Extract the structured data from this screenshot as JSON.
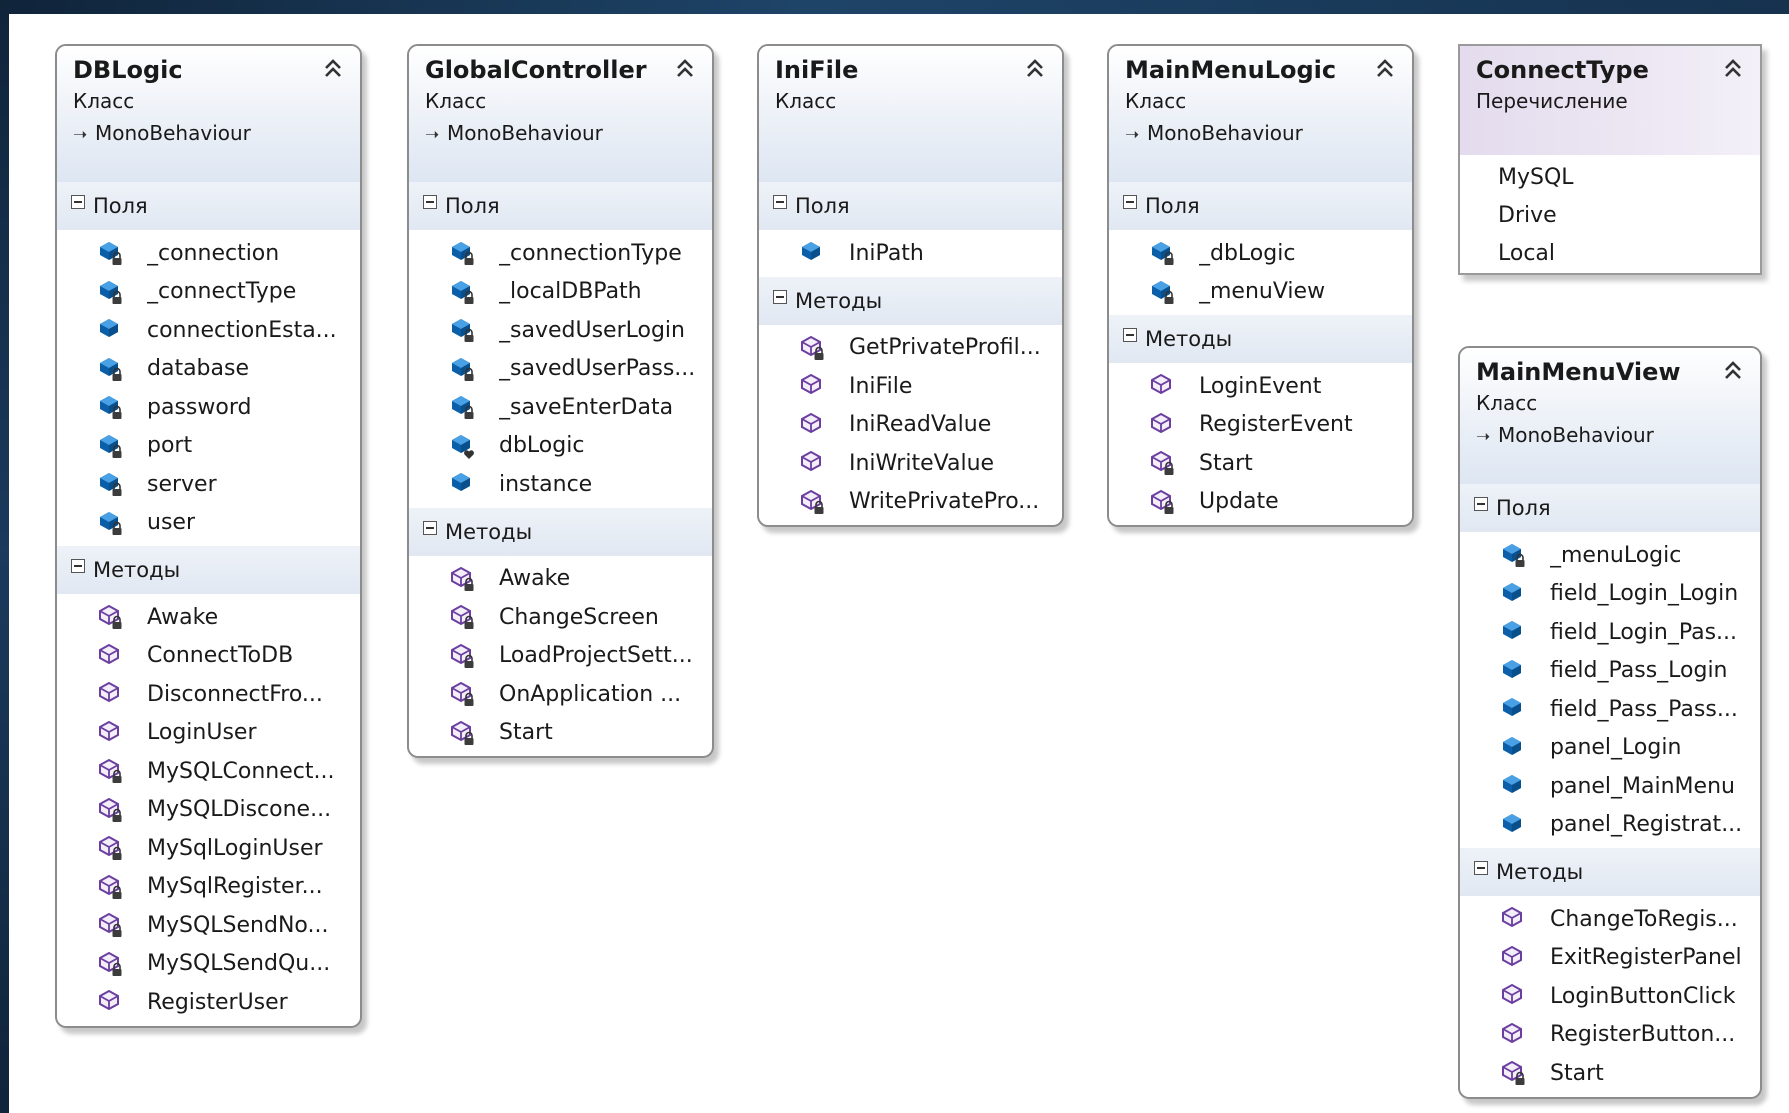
{
  "classes": [
    {
      "id": "dblogic",
      "name": "DBLogic",
      "stereotype": "Класс",
      "base": "MonoBehaviour",
      "fields_label": "Поля",
      "methods_label": "Методы",
      "fields": [
        {
          "name": "_connection",
          "icon": "private-field-icon"
        },
        {
          "name": "_connectType",
          "icon": "private-field-icon"
        },
        {
          "name": "connectionEsta...",
          "icon": "public-field-icon"
        },
        {
          "name": "database",
          "icon": "private-field-icon"
        },
        {
          "name": "password",
          "icon": "private-field-icon"
        },
        {
          "name": "port",
          "icon": "private-field-icon"
        },
        {
          "name": "server",
          "icon": "private-field-icon"
        },
        {
          "name": "user",
          "icon": "private-field-icon"
        }
      ],
      "methods": [
        {
          "name": "Awake",
          "icon": "private-method-icon"
        },
        {
          "name": "ConnectToDB",
          "icon": "public-method-icon"
        },
        {
          "name": "DisconnectFro...",
          "icon": "public-method-icon"
        },
        {
          "name": "LoginUser",
          "icon": "public-method-icon"
        },
        {
          "name": "MySQLConnect...",
          "icon": "private-method-icon"
        },
        {
          "name": "MySQLDiscone...",
          "icon": "private-method-icon"
        },
        {
          "name": "MySqlLoginUser",
          "icon": "private-method-icon"
        },
        {
          "name": "MySqlRegister...",
          "icon": "private-method-icon"
        },
        {
          "name": "MySQLSendNo...",
          "icon": "private-method-icon"
        },
        {
          "name": "MySQLSendQu...",
          "icon": "private-method-icon"
        },
        {
          "name": "RegisterUser",
          "icon": "public-method-icon"
        }
      ]
    },
    {
      "id": "globalcontroller",
      "name": "GlobalController",
      "stereotype": "Класс",
      "base": "MonoBehaviour",
      "fields_label": "Поля",
      "methods_label": "Методы",
      "fields": [
        {
          "name": "_connectionType",
          "icon": "private-field-icon"
        },
        {
          "name": "_localDBPath",
          "icon": "private-field-icon"
        },
        {
          "name": "_savedUserLogin",
          "icon": "private-field-icon"
        },
        {
          "name": "_savedUserPass...",
          "icon": "private-field-icon"
        },
        {
          "name": "_saveEnterData",
          "icon": "private-field-icon"
        },
        {
          "name": "dbLogic",
          "icon": "protected-field-icon"
        },
        {
          "name": "instance",
          "icon": "public-field-icon"
        }
      ],
      "methods": [
        {
          "name": "Awake",
          "icon": "private-method-icon"
        },
        {
          "name": "ChangeScreen",
          "icon": "private-method-icon"
        },
        {
          "name": "LoadProjectSett...",
          "icon": "private-method-icon"
        },
        {
          "name": "OnApplication ...",
          "icon": "private-method-icon"
        },
        {
          "name": "Start",
          "icon": "private-method-icon"
        }
      ]
    },
    {
      "id": "inifile",
      "name": "IniFile",
      "stereotype": "Класс",
      "base": "",
      "fields_label": "Поля",
      "methods_label": "Методы",
      "fields": [
        {
          "name": "IniPath",
          "icon": "public-field-icon"
        }
      ],
      "methods": [
        {
          "name": "GetPrivateProfil...",
          "icon": "private-method-icon"
        },
        {
          "name": "IniFile",
          "icon": "public-method-icon"
        },
        {
          "name": "IniReadValue",
          "icon": "public-method-icon"
        },
        {
          "name": "IniWriteValue",
          "icon": "public-method-icon"
        },
        {
          "name": "WritePrivatePro...",
          "icon": "private-method-icon"
        }
      ]
    },
    {
      "id": "mainmenulogic",
      "name": "MainMenuLogic",
      "stereotype": "Класс",
      "base": "MonoBehaviour",
      "fields_label": "Поля",
      "methods_label": "Методы",
      "fields": [
        {
          "name": "_dbLogic",
          "icon": "private-field-icon"
        },
        {
          "name": "_menuView",
          "icon": "private-field-icon"
        }
      ],
      "methods": [
        {
          "name": "LoginEvent",
          "icon": "public-method-icon"
        },
        {
          "name": "RegisterEvent",
          "icon": "public-method-icon"
        },
        {
          "name": "Start",
          "icon": "private-method-icon"
        },
        {
          "name": "Update",
          "icon": "private-method-icon"
        }
      ]
    },
    {
      "id": "mainmenuview",
      "name": "MainMenuView",
      "stereotype": "Класс",
      "base": "MonoBehaviour",
      "fields_label": "Поля",
      "methods_label": "Методы",
      "fields": [
        {
          "name": "_menuLogic",
          "icon": "private-field-icon"
        },
        {
          "name": "field_Login_Login",
          "icon": "public-field-icon"
        },
        {
          "name": "field_Login_Pas...",
          "icon": "public-field-icon"
        },
        {
          "name": "field_Pass_Login",
          "icon": "public-field-icon"
        },
        {
          "name": "field_Pass_Pass...",
          "icon": "public-field-icon"
        },
        {
          "name": "panel_Login",
          "icon": "public-field-icon"
        },
        {
          "name": "panel_MainMenu",
          "icon": "public-field-icon"
        },
        {
          "name": "panel_Registrat...",
          "icon": "public-field-icon"
        }
      ],
      "methods": [
        {
          "name": "ChangeToRegis...",
          "icon": "public-method-icon"
        },
        {
          "name": "ExitRegisterPanel",
          "icon": "public-method-icon"
        },
        {
          "name": "LoginButtonClick",
          "icon": "public-method-icon"
        },
        {
          "name": "RegisterButton...",
          "icon": "public-method-icon"
        },
        {
          "name": "Start",
          "icon": "private-method-icon"
        }
      ]
    }
  ],
  "enums": [
    {
      "id": "connecttype",
      "name": "ConnectType",
      "stereotype": "Перечисление",
      "values": [
        "MySQL",
        "Drive",
        "Local"
      ]
    }
  ],
  "colors": {
    "field_icon": "#0a5fa8",
    "method_icon": "#6b3fa0",
    "frame": "#16324f",
    "header_gradient_end": "#dde6f2",
    "enum_header": "#e7e0ef"
  },
  "icons": {
    "collapse": "double-chevron-up-icon",
    "base_arrow": "inheritance-arrow-icon",
    "section_toggle": "minus-box-icon"
  }
}
